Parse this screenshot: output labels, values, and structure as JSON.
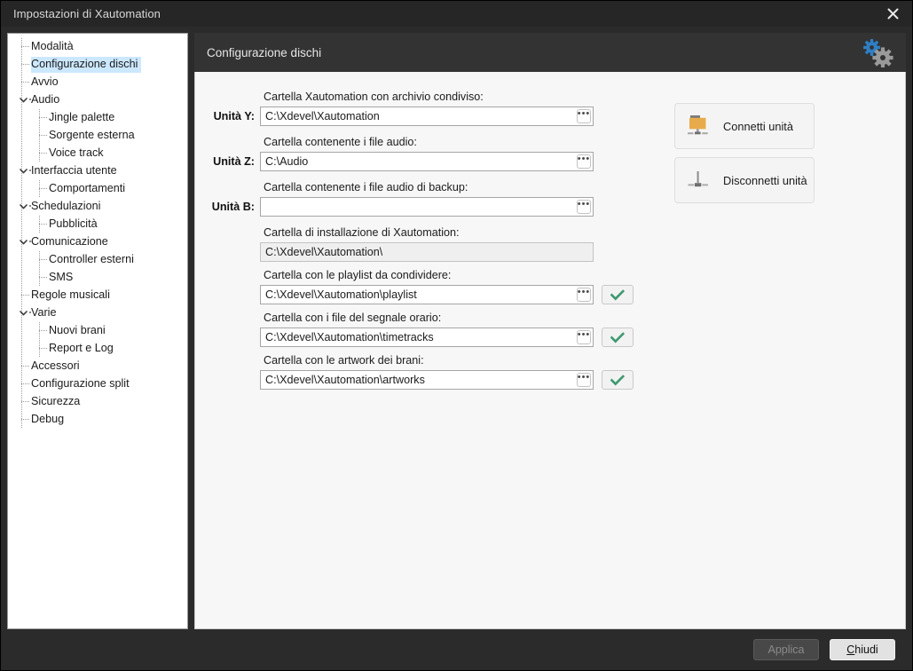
{
  "window": {
    "title": "Impostazioni di Xautomation",
    "close_icon": "close-icon"
  },
  "sidebar": {
    "items": [
      {
        "label": "Modalità",
        "level": 0,
        "expander": "none",
        "selected": false
      },
      {
        "label": "Configurazione dischi",
        "level": 0,
        "expander": "none",
        "selected": true
      },
      {
        "label": "Avvio",
        "level": 0,
        "expander": "none",
        "selected": false
      },
      {
        "label": "Audio",
        "level": 0,
        "expander": "expanded",
        "selected": false
      },
      {
        "label": "Jingle palette",
        "level": 1,
        "expander": "none",
        "selected": false
      },
      {
        "label": "Sorgente esterna",
        "level": 1,
        "expander": "none",
        "selected": false
      },
      {
        "label": "Voice track",
        "level": 1,
        "expander": "none",
        "selected": false
      },
      {
        "label": "Interfaccia utente",
        "level": 0,
        "expander": "expanded",
        "selected": false
      },
      {
        "label": "Comportamenti",
        "level": 1,
        "expander": "none",
        "selected": false
      },
      {
        "label": "Schedulazioni",
        "level": 0,
        "expander": "expanded",
        "selected": false
      },
      {
        "label": "Pubblicità",
        "level": 1,
        "expander": "none",
        "selected": false
      },
      {
        "label": "Comunicazione",
        "level": 0,
        "expander": "expanded",
        "selected": false
      },
      {
        "label": "Controller esterni",
        "level": 1,
        "expander": "none",
        "selected": false
      },
      {
        "label": "SMS",
        "level": 1,
        "expander": "none",
        "selected": false
      },
      {
        "label": "Regole musicali",
        "level": 0,
        "expander": "none",
        "selected": false
      },
      {
        "label": "Varie",
        "level": 0,
        "expander": "expanded",
        "selected": false
      },
      {
        "label": "Nuovi brani",
        "level": 1,
        "expander": "none",
        "selected": false
      },
      {
        "label": "Report e Log",
        "level": 1,
        "expander": "none",
        "selected": false
      },
      {
        "label": "Accessori",
        "level": 0,
        "expander": "none",
        "selected": false
      },
      {
        "label": "Configurazione split",
        "level": 0,
        "expander": "none",
        "selected": false
      },
      {
        "label": "Sicurezza",
        "level": 0,
        "expander": "none",
        "selected": false
      },
      {
        "label": "Debug",
        "level": 0,
        "expander": "none",
        "selected": false
      }
    ]
  },
  "content": {
    "header_title": "Configurazione dischi",
    "gears_icon": "gears-icon",
    "fields": [
      {
        "name": "unita-y",
        "unit": "Unità Y:",
        "label": "Cartella Xautomation con archivio condiviso:",
        "value": "C:\\Xdevel\\Xautomation",
        "placeholder": "",
        "readonly": false,
        "has_browse": true,
        "has_check": false
      },
      {
        "name": "unita-z",
        "unit": "Unità Z:",
        "label": "Cartella contenente i file audio:",
        "value": "C:\\Audio",
        "placeholder": "",
        "readonly": false,
        "has_browse": true,
        "has_check": false
      },
      {
        "name": "unita-b",
        "unit": "Unità B:",
        "label": "Cartella contenente i file audio di backup:",
        "value": "",
        "placeholder": "",
        "readonly": false,
        "has_browse": true,
        "has_check": false
      },
      {
        "name": "cartella-installazione",
        "unit": "",
        "label": "Cartella di installazione di Xautomation:",
        "value": "C:\\Xdevel\\Xautomation\\",
        "placeholder": "",
        "readonly": true,
        "has_browse": false,
        "has_check": false
      },
      {
        "name": "cartella-playlist",
        "unit": "",
        "label": "Cartella con le playlist da condividere:",
        "value": "C:\\Xdevel\\Xautomation\\playlist",
        "placeholder": "",
        "readonly": false,
        "has_browse": true,
        "has_check": true
      },
      {
        "name": "cartella-segnale-orario",
        "unit": "",
        "label": "Cartella con i file del segnale orario:",
        "value": "C:\\Xdevel\\Xautomation\\timetracks",
        "placeholder": "",
        "readonly": false,
        "has_browse": true,
        "has_check": true
      },
      {
        "name": "cartella-artwork",
        "unit": "",
        "label": "Cartella con le artwork dei brani:",
        "value": "C:\\Xdevel\\Xautomation\\artworks",
        "placeholder": "",
        "readonly": false,
        "has_browse": true,
        "has_check": true
      }
    ],
    "browse_label": "•••",
    "check_icon": "checkmark-icon",
    "actions": [
      {
        "name": "connetti-unita",
        "label": "Connetti unità",
        "icon": "network-folder-icon"
      },
      {
        "name": "disconnetti-unita",
        "label": "Disconnetti unità",
        "icon": "network-disconnect-icon"
      }
    ]
  },
  "footer": {
    "apply_label": "Applica",
    "close_accel": "C",
    "close_rest": "hiudi"
  },
  "colors": {
    "window_bg": "#2b2b2b",
    "titlebar_bg": "#262626",
    "header_bg": "#333333",
    "panel_bg": "#f7f7f7",
    "selection": "#cce8ff",
    "folder_orange": "#e8ab4b",
    "check_green": "#3d9970",
    "gear_blue": "#2e7fc4",
    "gear_gray": "#9a9a9a"
  }
}
